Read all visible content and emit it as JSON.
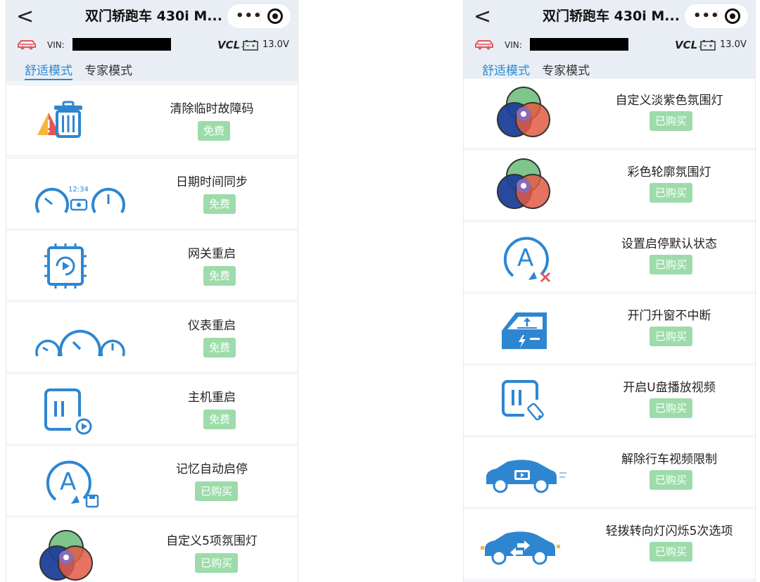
{
  "screens": [
    {
      "title": "双门轿跑车 430i M...",
      "back_icon": "chevron-left-icon",
      "more_label": "•••",
      "vin_label": "VIN:",
      "vcl_label": "VCL",
      "voltage": "13.0V",
      "tabs": [
        "舒适模式",
        "专家模式"
      ],
      "items": [
        {
          "name": "清除临时故障码",
          "status": "免费",
          "icon": "warning-trash-icon"
        },
        {
          "name": "日期时间同步",
          "status": "免费",
          "icon": "gauges-clock-icon"
        },
        {
          "name": "网关重启",
          "status": "免费",
          "icon": "chip-restart-icon"
        },
        {
          "name": "仪表重启",
          "status": "免费",
          "icon": "dashboard-gauges-icon"
        },
        {
          "name": "主机重启",
          "status": "免费",
          "icon": "headunit-restart-icon"
        },
        {
          "name": "记忆自动启停",
          "status": "已购买",
          "icon": "auto-start-stop-memory-icon"
        },
        {
          "name": "自定义5项氛围灯",
          "status": "已购买",
          "icon": "rgb-venn-icon"
        }
      ]
    },
    {
      "title": "双门轿跑车 430i M...",
      "back_icon": "chevron-left-icon",
      "more_label": "•••",
      "vin_label": "VIN:",
      "vcl_label": "VCL",
      "voltage": "13.0V",
      "tabs": [
        "舒适模式",
        "专家模式"
      ],
      "items": [
        {
          "name": "自定义淡紫色氛围灯",
          "status": "已购买",
          "icon": "rgb-venn-icon"
        },
        {
          "name": "彩色轮廓氛围灯",
          "status": "已购买",
          "icon": "rgb-venn-icon"
        },
        {
          "name": "设置启停默认状态",
          "status": "已购买",
          "icon": "auto-start-stop-off-icon"
        },
        {
          "name": "开门升窗不中断",
          "status": "已购买",
          "icon": "door-window-icon"
        },
        {
          "name": "开启U盘播放视频",
          "status": "已购买",
          "icon": "usb-video-icon"
        },
        {
          "name": "解除行车视频限制",
          "status": "已购买",
          "icon": "car-video-icon"
        },
        {
          "name": "轻拨转向灯闪烁5次选项",
          "status": "已购买",
          "icon": "car-turn-signal-icon"
        }
      ]
    }
  ],
  "colors": {
    "accent": "#2a8bd4",
    "badge": "#9ddcaa",
    "icon_blue": "#2e86d1"
  }
}
